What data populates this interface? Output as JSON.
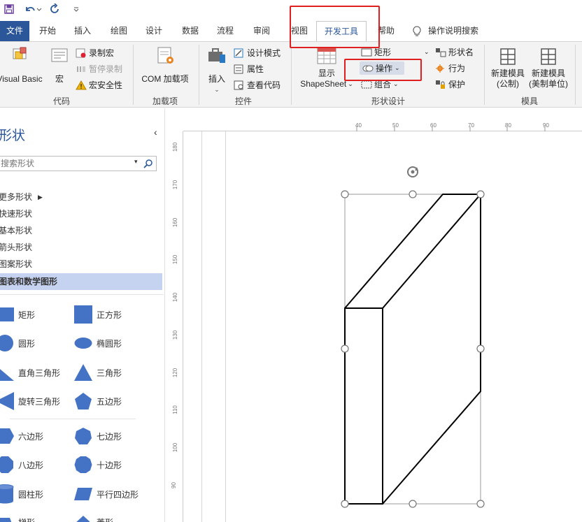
{
  "qat": {
    "save_icon": "save-icon",
    "undo_icon": "undo-icon",
    "redo_icon": "redo-icon",
    "customize_icon": "customize-icon"
  },
  "tabs": [
    {
      "label": "文件"
    },
    {
      "label": "开始"
    },
    {
      "label": "插入"
    },
    {
      "label": "绘图"
    },
    {
      "label": "设计"
    },
    {
      "label": "数据"
    },
    {
      "label": "流程"
    },
    {
      "label": "审阅"
    },
    {
      "label": "视图"
    },
    {
      "label": "开发工具"
    },
    {
      "label": "帮助"
    }
  ],
  "tell_me": "操作说明搜索",
  "ribbon": {
    "code": {
      "vb": "Visual Basic",
      "macro": "宏",
      "record_macro": "录制宏",
      "pause_record": "暂停录制",
      "macro_security": "宏安全性",
      "label": "代码"
    },
    "addins": {
      "com": "COM 加载项",
      "label": "加载项"
    },
    "controls": {
      "insert": "插入",
      "design_mode": "设计模式",
      "properties": "属性",
      "view_code": "查看代码",
      "label": "控件"
    },
    "shape_design": {
      "show_line1": "显示",
      "show_line2": "ShapeSheet",
      "rectangle": "矩形",
      "operation": "操作",
      "group": "组合",
      "shape_name": "形状名",
      "behavior": "行为",
      "protect": "保护",
      "label": "形状设计"
    },
    "stencil": {
      "new_metric_1": "新建模具",
      "new_metric_2": "(公制)",
      "new_us_1": "新建模具",
      "new_us_2": "(美制单位)",
      "label": "模具"
    }
  },
  "pane": {
    "title": "形状",
    "search_placeholder": "搜索形状",
    "stencils": [
      "更多形状",
      "快速形状",
      "基本形状",
      "箭头形状",
      "图案形状",
      "图表和数学图形"
    ],
    "shapes": [
      "矩形",
      "正方形",
      "圆形",
      "椭圆形",
      "直角三角形",
      "三角形",
      "旋转三角形",
      "五边形",
      "六边形",
      "七边形",
      "八边形",
      "十边形",
      "圆柱形",
      "平行四边形",
      "梯形",
      "菱形"
    ]
  },
  "ruler": {
    "h": [
      "40",
      "50",
      "60",
      "70",
      "80",
      "90"
    ],
    "v": [
      "180",
      "170",
      "160",
      "150",
      "140",
      "130",
      "120",
      "110",
      "100",
      "90"
    ]
  },
  "colors": {
    "accent": "#2b579a",
    "shape_fill": "#4472c4",
    "highlight": "#e02020",
    "selected_stencil": "#c5d2f0"
  }
}
